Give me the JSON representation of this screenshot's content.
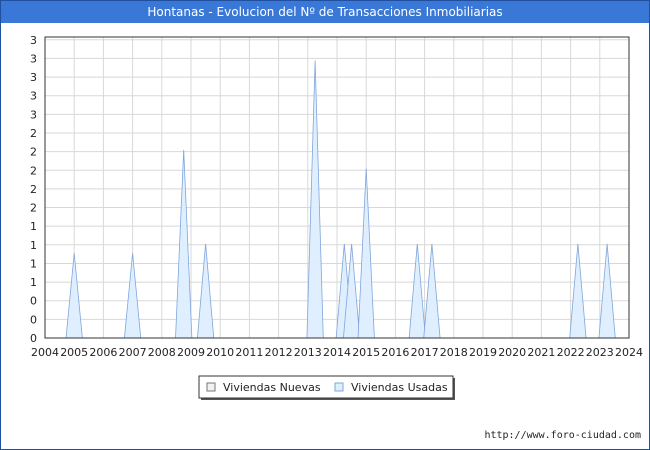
{
  "chart_data": {
    "type": "area",
    "title": "Hontanas - Evolucion del Nº de Transacciones Inmobiliarias",
    "x_ticks": [
      2004,
      2005,
      2006,
      2007,
      2008,
      2009,
      2010,
      2011,
      2012,
      2013,
      2014,
      2015,
      2016,
      2017,
      2018,
      2019,
      2020,
      2021,
      2022,
      2023,
      2024
    ],
    "y_tick_labels": [
      "0",
      "0",
      "0",
      "1",
      "1",
      "1",
      "1",
      "2",
      "2",
      "2",
      "2",
      "2",
      "3",
      "3",
      "3",
      "3",
      "3"
    ],
    "ylim": [
      0,
      3.2
    ],
    "xlim": [
      2004,
      2024
    ],
    "grid": true,
    "legend_position": "bottom",
    "series": [
      {
        "name": "Viviendas Nuevas",
        "color": "#f2f2f2",
        "x": [],
        "values": []
      },
      {
        "name": "Viviendas Usadas",
        "color": "#ddeeff",
        "x": [
          2005,
          2007,
          2008.75,
          2009.5,
          2013.25,
          2014.25,
          2014.5,
          2015,
          2016.75,
          2017.25,
          2022.25,
          2023.25
        ],
        "values": [
          0.9,
          0.9,
          2.0,
          1.0,
          2.95,
          1.0,
          1.0,
          1.8,
          1.0,
          1.0,
          1.0,
          1.0
        ]
      }
    ]
  },
  "source_text": "http://www.foro-ciudad.com",
  "colors": {
    "title_bar": "#3a78d8",
    "grid": "#d8d8d8",
    "fill_used": "#ddeeff",
    "line_used": "#7fa6dc"
  }
}
